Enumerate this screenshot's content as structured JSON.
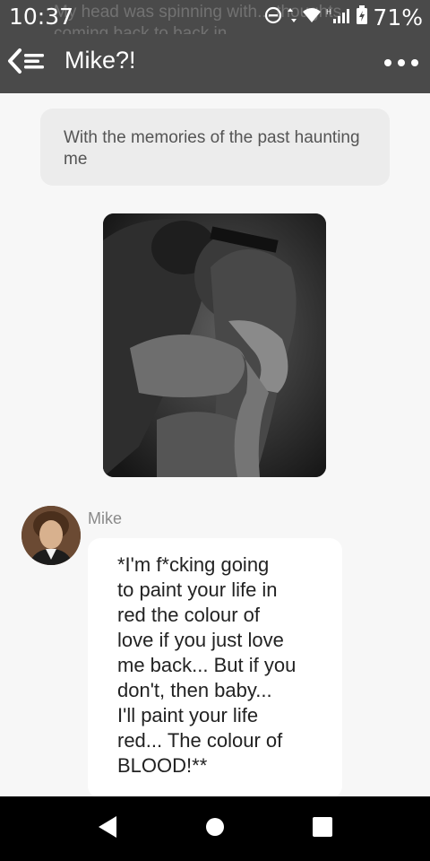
{
  "status_bar": {
    "time": "10:37",
    "battery": "71%",
    "background_text": "My head was spinning with... thoughts coming back to back in",
    "icons": [
      "do-not-disturb-icon",
      "data-arrows-icon",
      "wifi-icon",
      "signal-icon",
      "battery-icon"
    ]
  },
  "header": {
    "title": "Mike?!",
    "back_icon": "back-menu-icon",
    "more_icon": "more-icon",
    "background_color": "#4a4a4a"
  },
  "chat": {
    "narration": "With the memories of the past haunting me",
    "image_icon": "story-image",
    "sender": "Mike",
    "message_lines": [
      "*I'm f*cking going",
      "to paint your life in",
      "red the colour of",
      "love if you just love",
      "me back... But if you",
      "don't, then baby...",
      "I'll paint your life",
      "red... The colour of",
      "BLOOD!**"
    ]
  },
  "nav_bar": {
    "icons": [
      "nav-back-icon",
      "nav-home-icon",
      "nav-recents-icon"
    ]
  }
}
